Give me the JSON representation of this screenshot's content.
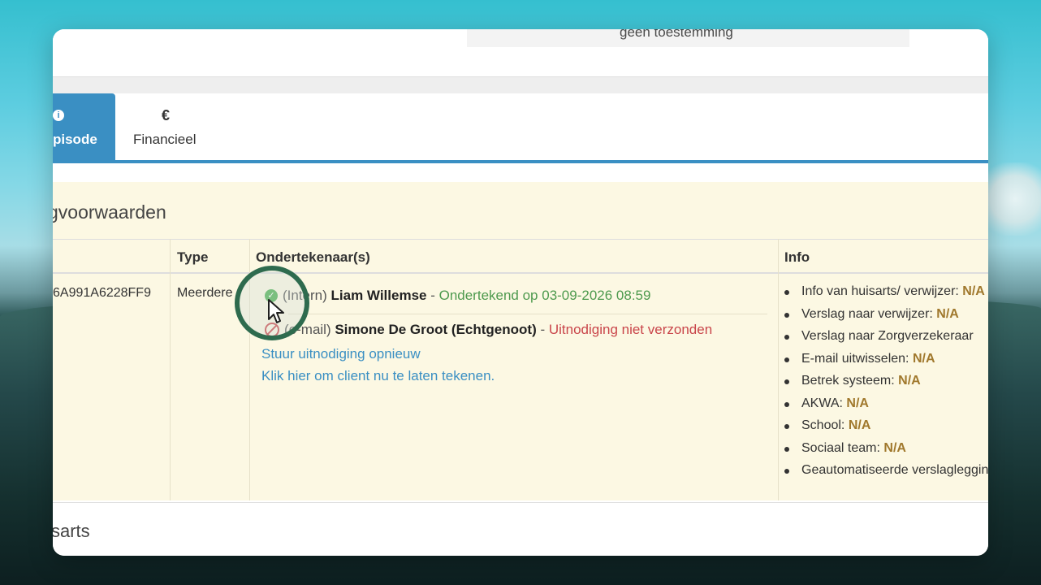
{
  "header": {
    "consent_text": "geen toestemming"
  },
  "tabs": [
    {
      "label": "pisode",
      "icon": "info-icon"
    },
    {
      "label": "Financieel",
      "icon": "euro-icon",
      "icon_glyph": "€"
    }
  ],
  "section": {
    "title": "gvoorwaarden"
  },
  "table": {
    "headers": {
      "type": "Type",
      "signers": "Ondertekenaar(s)",
      "info": "Info"
    },
    "row": {
      "id": "6A991A6228FF9",
      "type": "Meerdere",
      "signers": [
        {
          "role": "(Intern)",
          "name": "Liam Willemse",
          "sep": " - ",
          "status": "Ondertekend op 03-09-2026 08:59",
          "state": "signed"
        },
        {
          "role": "(e-mail)",
          "name": "Simone De Groot (Echtgenoot)",
          "sep": " - ",
          "status": "Uitnodiging niet verzonden",
          "state": "not-sent"
        }
      ],
      "links": {
        "resend": "Stuur uitnodiging opnieuw",
        "sign_now": "Klik hier om client nu te laten tekenen."
      },
      "info": [
        {
          "label": "Info van huisarts/ verwijzer: ",
          "value": "N/A"
        },
        {
          "label": "Verslag naar verwijzer: ",
          "value": "N/A"
        },
        {
          "label": "Verslag naar Zorgverzekeraar",
          "value": ""
        },
        {
          "label": "E-mail uitwisselen: ",
          "value": "N/A"
        },
        {
          "label": "Betrek systeem: ",
          "value": "N/A"
        },
        {
          "label": "AKWA: ",
          "value": "N/A"
        },
        {
          "label": "School: ",
          "value": "N/A"
        },
        {
          "label": "Sociaal team: ",
          "value": "N/A"
        },
        {
          "label": "Geautomatiseerde verslaglegging",
          "value": ""
        }
      ]
    }
  },
  "bottom": {
    "title": "sarts"
  },
  "colors": {
    "accent": "#3a8fc3",
    "section_bg": "#fcf8e3",
    "ok": "#4e9a4e",
    "error": "#c9454a",
    "na": "#a0782c"
  }
}
